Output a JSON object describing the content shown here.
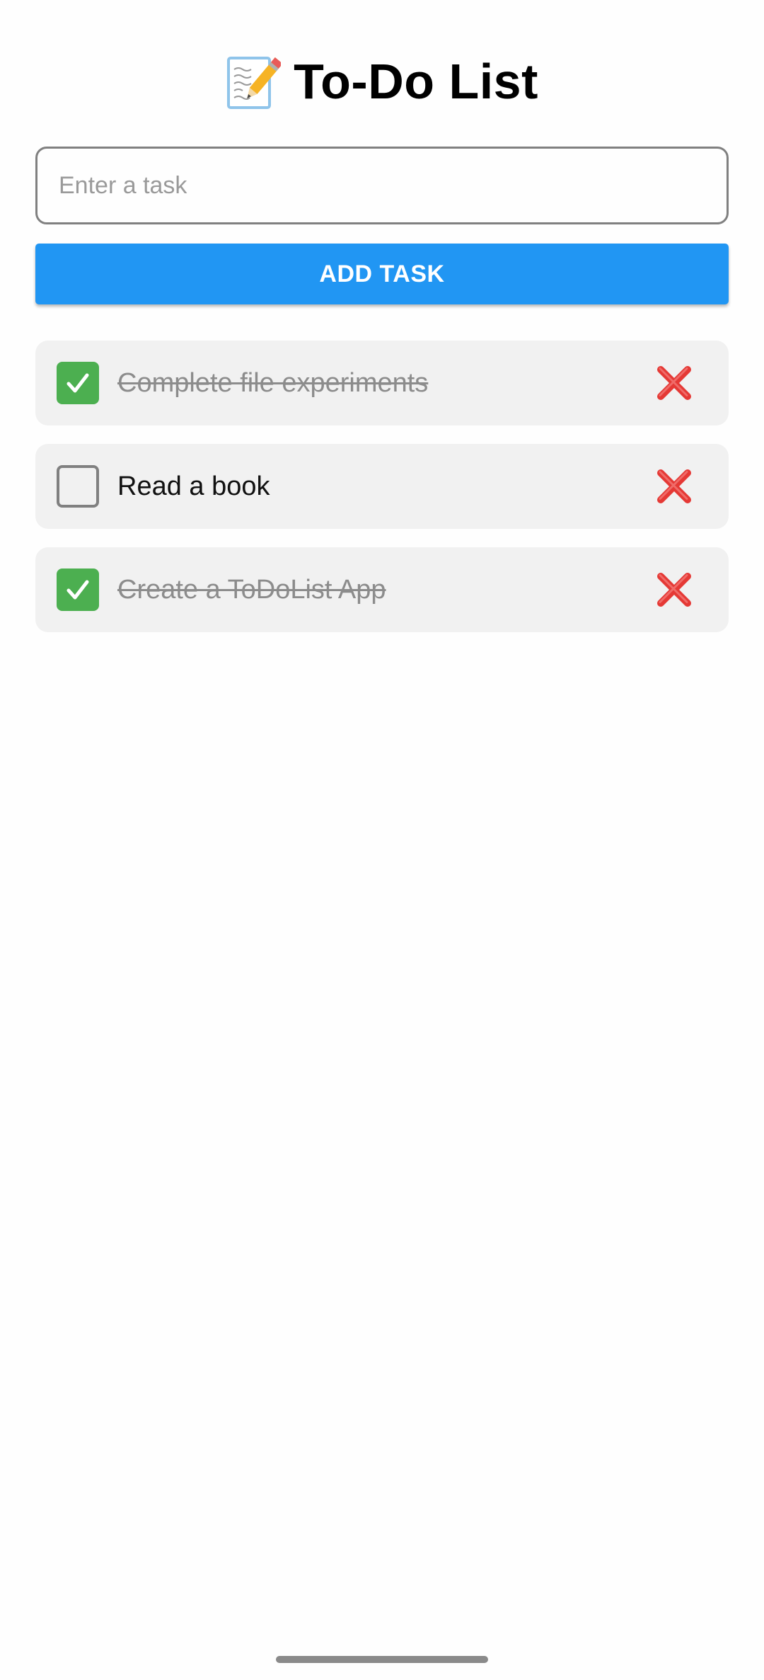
{
  "header": {
    "title": "To-Do List",
    "icon": "memo-pencil-icon"
  },
  "input": {
    "placeholder": "Enter a task",
    "value": ""
  },
  "add_button": {
    "label": "ADD TASK"
  },
  "tasks": [
    {
      "text": "Complete file experiments",
      "completed": true
    },
    {
      "text": "Read a book",
      "completed": false
    },
    {
      "text": "Create a ToDoList App",
      "completed": true
    }
  ],
  "colors": {
    "accent": "#2196f3",
    "check": "#4caf50",
    "delete": "#e53935",
    "item_bg": "#f1f1f1"
  }
}
